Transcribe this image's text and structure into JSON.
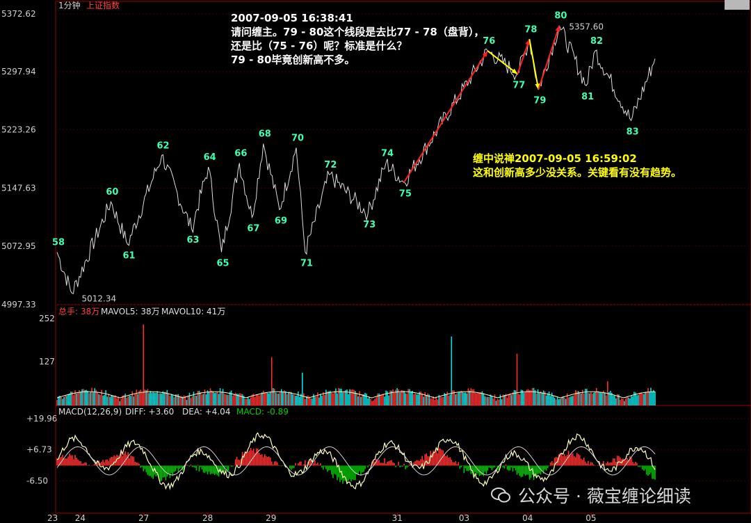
{
  "header": {
    "period": "1分钟",
    "index_name": "上证指数"
  },
  "price_panel": {
    "y_ticks": [
      "5372.62",
      "5297.94",
      "5223.26",
      "5147.63",
      "5072.95",
      "4997.33"
    ],
    "y_tick_values": [
      5372.62,
      5297.94,
      5223.26,
      5147.63,
      5072.95,
      4997.33
    ],
    "ylim": [
      4997.33,
      5372.62
    ],
    "low_mark": "5012.34",
    "high_mark": "5357.60"
  },
  "x_ticks": [
    {
      "label": "23",
      "pos": 0.0
    },
    {
      "label": "24",
      "pos": 0.03
    },
    {
      "label": "27",
      "pos": 0.136
    },
    {
      "label": "28",
      "pos": 0.243
    },
    {
      "label": "29",
      "pos": 0.349
    },
    {
      "label": "31",
      "pos": 0.56
    },
    {
      "label": "03",
      "pos": 0.672
    },
    {
      "label": "04",
      "pos": 0.778
    },
    {
      "label": "05",
      "pos": 0.884
    }
  ],
  "chart_data": {
    "type": "line",
    "x_unit": "session index",
    "pivots": [
      {
        "label": "58",
        "x": 0.0,
        "y": 5065
      },
      {
        "label": "",
        "x": 0.025,
        "y": 5012
      },
      {
        "label": "60",
        "x": 0.09,
        "y": 5130
      },
      {
        "label": "61",
        "x": 0.118,
        "y": 5075
      },
      {
        "label": "62",
        "x": 0.175,
        "y": 5190
      },
      {
        "label": "63",
        "x": 0.225,
        "y": 5095
      },
      {
        "label": "64",
        "x": 0.253,
        "y": 5175
      },
      {
        "label": "65",
        "x": 0.275,
        "y": 5065
      },
      {
        "label": "66",
        "x": 0.305,
        "y": 5180
      },
      {
        "label": "67",
        "x": 0.326,
        "y": 5110
      },
      {
        "label": "68",
        "x": 0.345,
        "y": 5205
      },
      {
        "label": "69",
        "x": 0.372,
        "y": 5120
      },
      {
        "label": "70",
        "x": 0.4,
        "y": 5200
      },
      {
        "label": "71",
        "x": 0.415,
        "y": 5065
      },
      {
        "label": "72",
        "x": 0.455,
        "y": 5165
      },
      {
        "label": "73",
        "x": 0.52,
        "y": 5115
      },
      {
        "label": "74",
        "x": 0.55,
        "y": 5180
      },
      {
        "label": "75",
        "x": 0.58,
        "y": 5155
      },
      {
        "label": "76",
        "x": 0.72,
        "y": 5325
      },
      {
        "label": "77",
        "x": 0.77,
        "y": 5295
      },
      {
        "label": "78",
        "x": 0.79,
        "y": 5340
      },
      {
        "label": "79",
        "x": 0.805,
        "y": 5275
      },
      {
        "label": "80",
        "x": 0.84,
        "y": 5357.6
      },
      {
        "label": "81",
        "x": 0.885,
        "y": 5280
      },
      {
        "label": "82",
        "x": 0.9,
        "y": 5325
      },
      {
        "label": "83",
        "x": 0.96,
        "y": 5235
      },
      {
        "label": "",
        "x": 1.0,
        "y": 5315
      }
    ],
    "arrows": [
      {
        "from": "75",
        "to": "76",
        "color": "#ff2020"
      },
      {
        "from": "76",
        "to": "77",
        "color": "#ffff00"
      },
      {
        "from": "77",
        "to": "78",
        "color": "#ff2020"
      },
      {
        "from": "78",
        "to": "79",
        "color": "#ffff00"
      },
      {
        "from": "79",
        "to": "80",
        "color": "#ff2020"
      }
    ],
    "volume": {
      "header": {
        "label": "总手:",
        "value": "38万",
        "ma5": "MAVOL5: 38万",
        "ma10": "MAVOL10: 41万"
      },
      "y_ticks": [
        "252",
        "127"
      ],
      "ylim": [
        0,
        252
      ],
      "spikes": [
        {
          "x": 0.145,
          "v": 235
        },
        {
          "x": 0.36,
          "v": 140
        },
        {
          "x": 0.66,
          "v": 200
        },
        {
          "x": 0.77,
          "v": 150
        },
        {
          "x": 0.41,
          "v": 95
        },
        {
          "x": 0.92,
          "v": 70
        }
      ]
    },
    "macd": {
      "header": {
        "label": "MACD(12,26,9)",
        "diff": "DIFF: +3.60",
        "dea": "DEA: +4.04",
        "macd": "MACD: -0.89"
      },
      "y_ticks": [
        "+19.96",
        "+6.73",
        "-6.50"
      ],
      "y_tick_values": [
        19.96,
        6.73,
        -6.5
      ],
      "ylim": [
        -19.7,
        19.96
      ]
    }
  },
  "question": {
    "time": "2007-09-05 16:38:41",
    "line1": "请问缠主。79 - 80这个线段是去比77 - 78（盘背），",
    "line2": "还是比（75 - 76）呢？标准是什么？",
    "line3": "79 - 80毕竟创新高不多。"
  },
  "answer": {
    "line1": "缠中说禅2007-09-05 16:59:02",
    "line2": "这和创新高多少没关系。关键看有没有趋势。"
  },
  "watermark": {
    "text": "公众号 · 薇宝缠论细读",
    "icon": "wechat-icon"
  },
  "colors": {
    "price": "#dcdcdc",
    "up": "#ff3030",
    "down": "#00e0e0",
    "diff": "#ffffc0",
    "dea": "#e0e0e0",
    "macd_pos": "#ff3030",
    "macd_neg": "#00c000",
    "axis": "#b00000",
    "label": "#40ffb0"
  }
}
